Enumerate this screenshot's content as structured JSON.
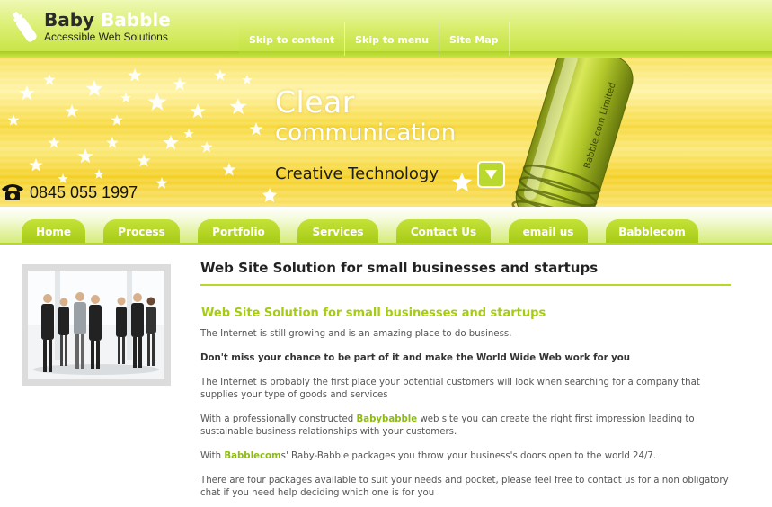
{
  "header": {
    "logo_word1": "Baby",
    "logo_word2": "Babble",
    "tagline": "Accessible Web Solutions",
    "links": [
      "Skip to content",
      "Skip to menu",
      "Site Map"
    ]
  },
  "banner": {
    "headline_line1": "Clear",
    "headline_line2": "communication",
    "subline": "Creative Technology",
    "phone": "0845 055 1997",
    "bottle_label": "Babble.com Limited"
  },
  "nav": {
    "items": [
      "Home",
      "Process",
      "Portfolio",
      "Services",
      "Contact Us",
      "email us",
      "Babblecom"
    ]
  },
  "content": {
    "heading": "Web Site Solution for small businesses and startups",
    "subheading": "Web Site Solution for small businesses and startups",
    "p1": "The Internet is still growing and is an amazing place to do business.",
    "p2": "Don't miss your chance to be part of it and make the World Wide Web work for you",
    "p3": "The Internet is probably the first place your potential customers will look when searching for a company that supplies your type of goods and services",
    "p4_before": "With a professionally constructed ",
    "p4_highlight": "Babybabble",
    "p4_after": " web site you can create the right first impression leading to sustainable business relationships with your customers.",
    "p5_before": "With ",
    "p5_highlight": "Babblecom",
    "p5_after": "s' Baby-Babble packages you throw your business's doors open to the world 24/7.",
    "p6": "There are four packages available to suit your needs and pocket, please feel free to contact us for a non obligatory chat if you need help deciding which one is for you"
  },
  "colors": {
    "accent_green": "#a6cc12",
    "banner_yellow": "#f7d838",
    "nav_green": "#a7cb17"
  },
  "icons": [
    "bottle-logo-icon",
    "phone-icon",
    "arrow-down-icon",
    "star-sparkle-icon"
  ]
}
